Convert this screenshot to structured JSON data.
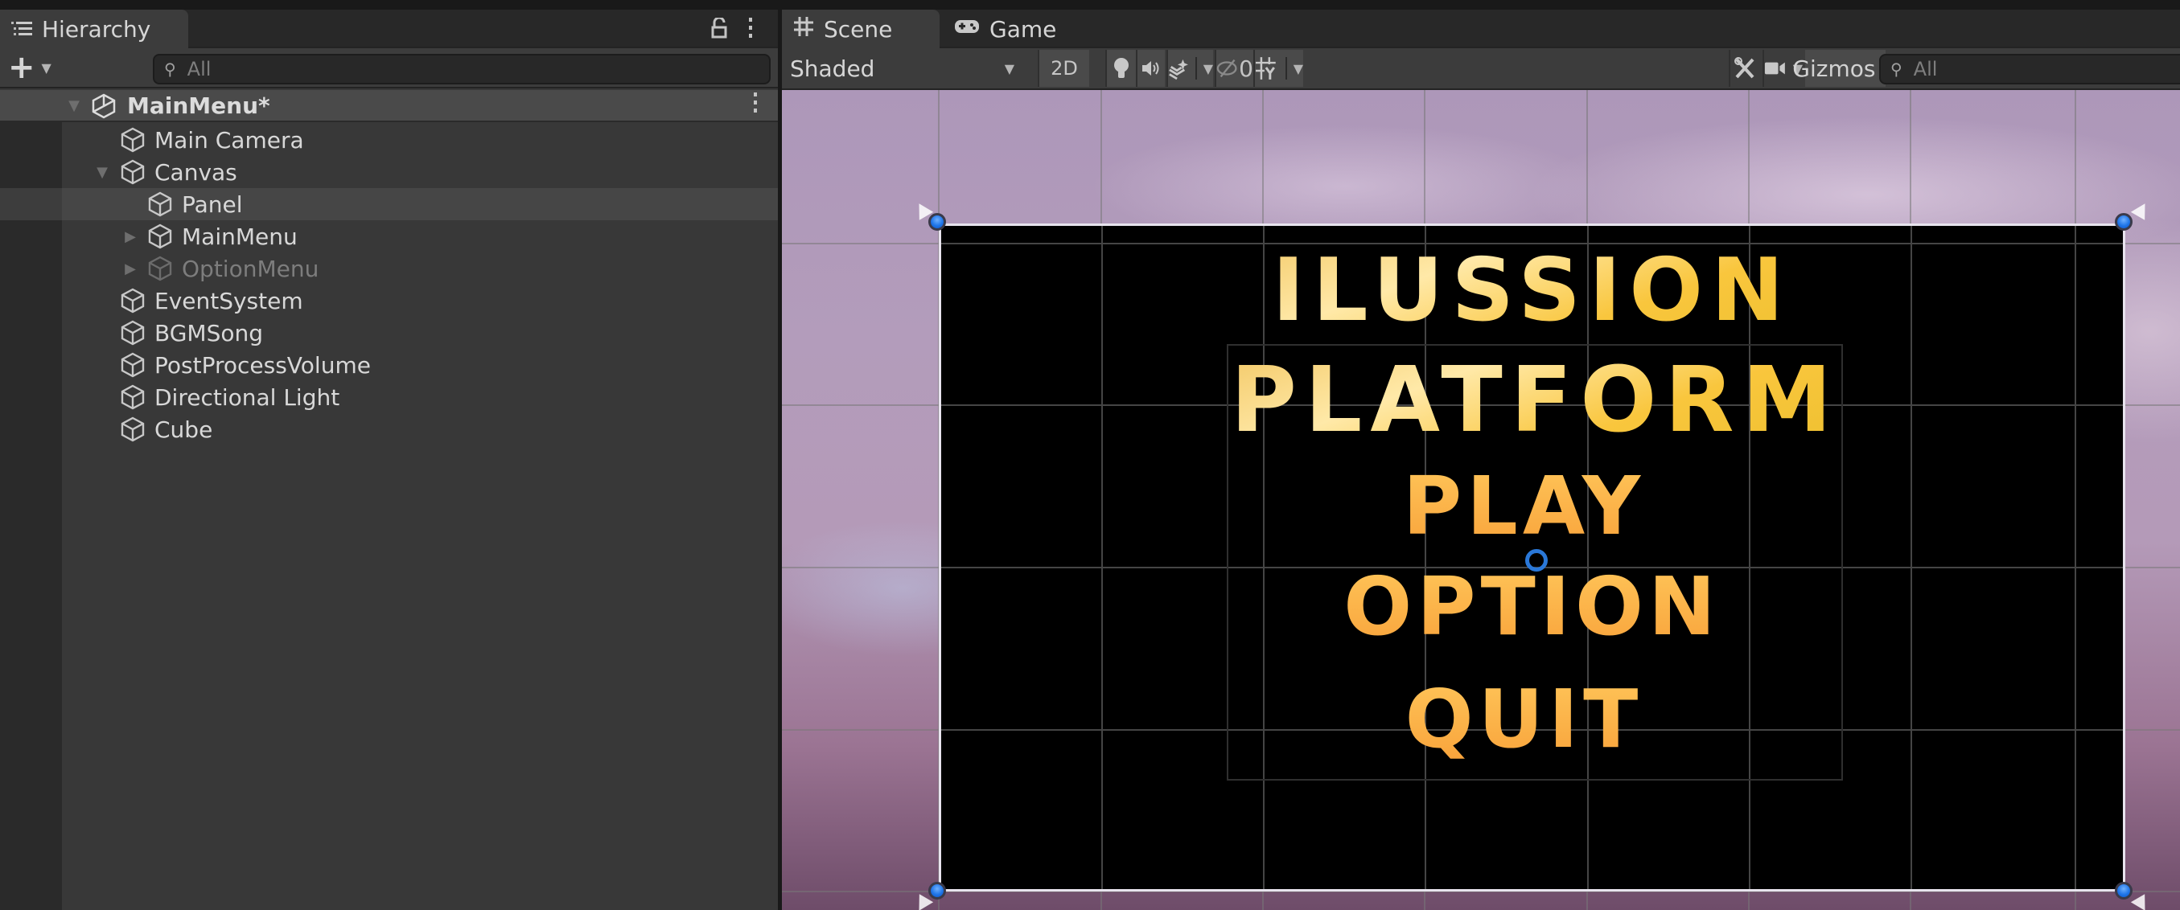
{
  "hierarchy": {
    "tab_label": "Hierarchy",
    "tab_icon": "list-icon",
    "lock_icon": "lock-icon",
    "menu_icon": "kebab-menu-icon",
    "add_icon": "plus-icon",
    "search": {
      "placeholder": "All",
      "value": ""
    },
    "scene": {
      "name": "MainMenu*",
      "icon": "unity-logo-icon",
      "expanded": true
    },
    "items": [
      {
        "label": "Main Camera",
        "depth": 1,
        "expandable": false,
        "active": true,
        "selected": false
      },
      {
        "label": "Canvas",
        "depth": 1,
        "expandable": true,
        "expanded": true,
        "active": true,
        "selected": false
      },
      {
        "label": "Panel",
        "depth": 2,
        "expandable": false,
        "active": true,
        "selected": true
      },
      {
        "label": "MainMenu",
        "depth": 2,
        "expandable": true,
        "expanded": false,
        "active": true,
        "selected": false
      },
      {
        "label": "OptionMenu",
        "depth": 2,
        "expandable": true,
        "expanded": false,
        "active": false,
        "selected": false
      },
      {
        "label": "EventSystem",
        "depth": 1,
        "expandable": false,
        "active": true,
        "selected": false
      },
      {
        "label": "BGMSong",
        "depth": 1,
        "expandable": false,
        "active": true,
        "selected": false
      },
      {
        "label": "PostProcessVolume",
        "depth": 1,
        "expandable": false,
        "active": true,
        "selected": false
      },
      {
        "label": "Directional Light",
        "depth": 1,
        "expandable": false,
        "active": true,
        "selected": false
      },
      {
        "label": "Cube",
        "depth": 1,
        "expandable": false,
        "active": true,
        "selected": false
      }
    ]
  },
  "scene_view": {
    "tabs": [
      {
        "label": "Scene",
        "icon": "grid-icon",
        "active": true
      },
      {
        "label": "Game",
        "icon": "gamepad-icon",
        "active": false
      }
    ],
    "toolbar": {
      "shading_mode": "Shaded",
      "toggle_2d": "2D",
      "lighting_icon": "lightbulb-icon",
      "audio_icon": "speaker-icon",
      "effects_icon": "effects-layers-icon",
      "hidden_objects_count": "0",
      "hidden_icon": "eye-slash-icon",
      "grid_icon": "grid-snap-icon",
      "tools_icon": "tools-icon",
      "camera_icon": "camera-icon",
      "gizmos_label": "Gizmos",
      "search_placeholder": "All"
    },
    "canvas_content": {
      "title_line1": "ILUSSION",
      "title_line2": "PLATFORM",
      "buttons": [
        "PLAY",
        "OPTION",
        "QUIT"
      ],
      "panel_color": "#000000",
      "title_color": "#F5C842",
      "button_color": "#FFB347",
      "selection_handle_color": "#1F75E8"
    }
  }
}
